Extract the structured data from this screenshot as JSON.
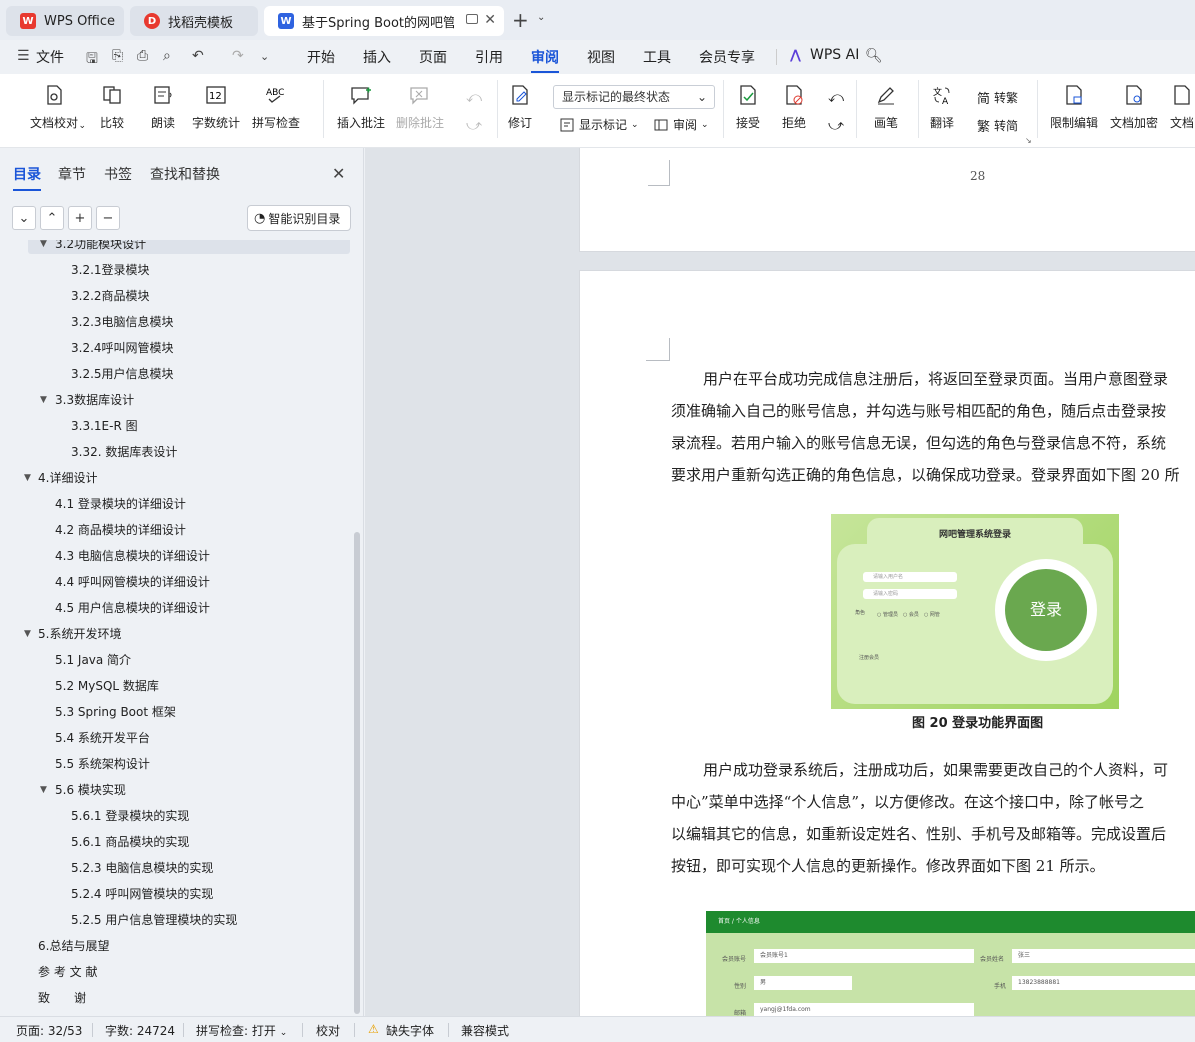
{
  "tabs": [
    {
      "label": "WPS Office",
      "logo": "wps-logo-icon"
    },
    {
      "label": "找稻壳模板",
      "logo": "docer-logo-icon"
    },
    {
      "label": "基于Spring Boot的网吧管理系统",
      "logo": "word-doc-icon"
    }
  ],
  "menu": {
    "file": "文件",
    "items": [
      "开始",
      "插入",
      "页面",
      "引用",
      "审阅",
      "视图",
      "工具",
      "会员专享"
    ],
    "active": "审阅",
    "ai": "WPS AI"
  },
  "ribbon": {
    "doc_proofread": "文档校对",
    "compare": "比较",
    "read_aloud": "朗读",
    "word_count": "字数统计",
    "spell_check": "拼写检查",
    "insert_comment": "插入批注",
    "delete_comment": "删除批注",
    "revise": "修订",
    "markup_state": "显示标记的最终状态",
    "show_markup": "显示标记",
    "review": "审阅",
    "accept": "接受",
    "reject": "拒绝",
    "pen": "画笔",
    "translate": "翻译",
    "to_traditional": "转繁",
    "to_simplified": "转简",
    "restrict_edit": "限制编辑",
    "doc_encrypt": "文档加密",
    "doc_more": "文档"
  },
  "nav": {
    "tabs": [
      "目录",
      "章节",
      "书签",
      "查找和替换"
    ],
    "smart_toc": "智能识别目录",
    "toc": [
      {
        "label": "3.2功能模块设计",
        "level": 2,
        "expanded": true,
        "selected": true
      },
      {
        "label": "3.2.1登录模块",
        "level": 3
      },
      {
        "label": "3.2.2商品模块",
        "level": 3
      },
      {
        "label": "3.2.3电脑信息模块",
        "level": 3
      },
      {
        "label": "3.2.4呼叫网管模块",
        "level": 3
      },
      {
        "label": "3.2.5用户信息模块",
        "level": 3
      },
      {
        "label": "3.3数据库设计",
        "level": 2,
        "expanded": true
      },
      {
        "label": "3.3.1E-R 图",
        "level": 3
      },
      {
        "label": "3.32. 数据库表设计",
        "level": 3
      },
      {
        "label": "4.详细设计",
        "level": 1,
        "expanded": true
      },
      {
        "label": "4.1 登录模块的详细设计",
        "level": 2
      },
      {
        "label": "4.2 商品模块的详细设计",
        "level": 2
      },
      {
        "label": "4.3 电脑信息模块的详细设计",
        "level": 2
      },
      {
        "label": "4.4 呼叫网管模块的详细设计",
        "level": 2
      },
      {
        "label": "4.5 用户信息模块的详细设计",
        "level": 2
      },
      {
        "label": "5.系统开发环境",
        "level": 1,
        "expanded": true
      },
      {
        "label": "5.1 Java 简介",
        "level": 2
      },
      {
        "label": "5.2 MySQL 数据库",
        "level": 2
      },
      {
        "label": "5.3 Spring Boot 框架",
        "level": 2
      },
      {
        "label": "5.4 系统开发平台",
        "level": 2
      },
      {
        "label": "5.5 系统架构设计",
        "level": 2
      },
      {
        "label": "5.6 模块实现",
        "level": 2,
        "expanded": true
      },
      {
        "label": "5.6.1 登录模块的实现",
        "level": 3
      },
      {
        "label": "5.6.1 商品模块的实现",
        "level": 3
      },
      {
        "label": "5.2.3 电脑信息模块的实现",
        "level": 3
      },
      {
        "label": "5.2.4 呼叫网管模块的实现",
        "level": 3
      },
      {
        "label": "5.2.5 用户信息管理模块的实现",
        "level": 3
      },
      {
        "label": "6.总结与展望",
        "level": 1
      },
      {
        "label": "参 考 文 献",
        "level": 1
      },
      {
        "label": "致　　谢",
        "level": 1
      }
    ]
  },
  "document": {
    "page_number": "28",
    "para1": [
      "用户在平台成功完成信息注册后，将返回至登录页面。当用户意图登录",
      "须准确输入自己的账号信息，并勾选与账号相匹配的角色，随后点击登录按",
      "录流程。若用户输入的账号信息无误，但勾选的角色与登录信息不符，系统",
      "要求用户重新勾选正确的角色信息，以确保成功登录。登录界面如下图 20 所"
    ],
    "fig20": {
      "title": "网吧管理系统登录",
      "user_placeholder": "请输入用户名",
      "pwd_placeholder": "请输入密码",
      "role_label": "角色",
      "roles": [
        "管理员",
        "会员",
        "网管"
      ],
      "register": "注册会员",
      "login": "登录"
    },
    "caption20": "图 20 登录功能界面图",
    "para2": [
      "用户成功登录系统后，注册成功后，如果需要更改自己的个人资料，可",
      "中心”菜单中选择“个人信息”，以方便修改。在这个接口中，除了帐号之",
      "以编辑其它的信息，如重新设定姓名、性别、手机号及邮箱等。完成设置后",
      "按钮，即可实现个人信息的更新操作。修改界面如下图 21 所示。"
    ],
    "fig21": {
      "breadcrumb": "首页 / 个人信息",
      "account_label": "会员账号",
      "account_value": "会员账号1",
      "name_label": "会员姓名",
      "name_value": "张三",
      "gender_label": "性别",
      "gender_value": "男",
      "phone_label": "手机",
      "phone_value": "13823888881",
      "email_label": "邮箱",
      "email_value": "yangj@1fda.com"
    }
  },
  "status": {
    "page": "页面: 32/53",
    "words": "字数: 24724",
    "spell": "拼写检查: 打开",
    "proof": "校对",
    "missing_font": "缺失字体",
    "compat": "兼容模式"
  },
  "colors": {
    "accent": "#1a55d8",
    "wps_red": "#e8392f",
    "fig_green": "#8ec85a",
    "login_green": "#6aa84f",
    "fig21_header": "#1e8a2e"
  }
}
